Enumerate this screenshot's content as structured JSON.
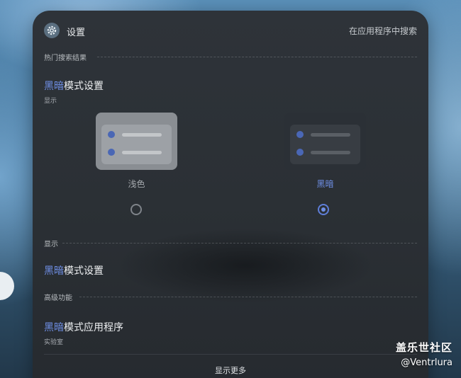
{
  "header": {
    "title": "设置",
    "search_in_apps": "在应用程序中搜索",
    "icon": "gear-icon"
  },
  "sections": {
    "popular": "热门搜索结果",
    "display": "显示",
    "advanced": "高级功能"
  },
  "results": {
    "dark_mode_settings": {
      "highlight": "黑暗",
      "rest": "模式设置",
      "sub": "显示"
    },
    "dark_mode_settings_2": {
      "highlight": "黑暗",
      "rest": "模式设置"
    },
    "dark_mode_apps": {
      "highlight": "黑暗",
      "rest": "模式应用程序",
      "sub": "实验室"
    }
  },
  "theme_options": [
    {
      "label": "浅色",
      "selected": false,
      "label_color": "#a4a8ad"
    },
    {
      "label": "黑暗",
      "selected": true,
      "label_color": "#6f8fe6"
    }
  ],
  "footer": {
    "show_more": "显示更多"
  },
  "watermark": {
    "line1": "盖乐世社区",
    "line2": "@Ventrlura"
  },
  "colors": {
    "accent": "#6f8fe6",
    "panel": "#2b3035"
  }
}
